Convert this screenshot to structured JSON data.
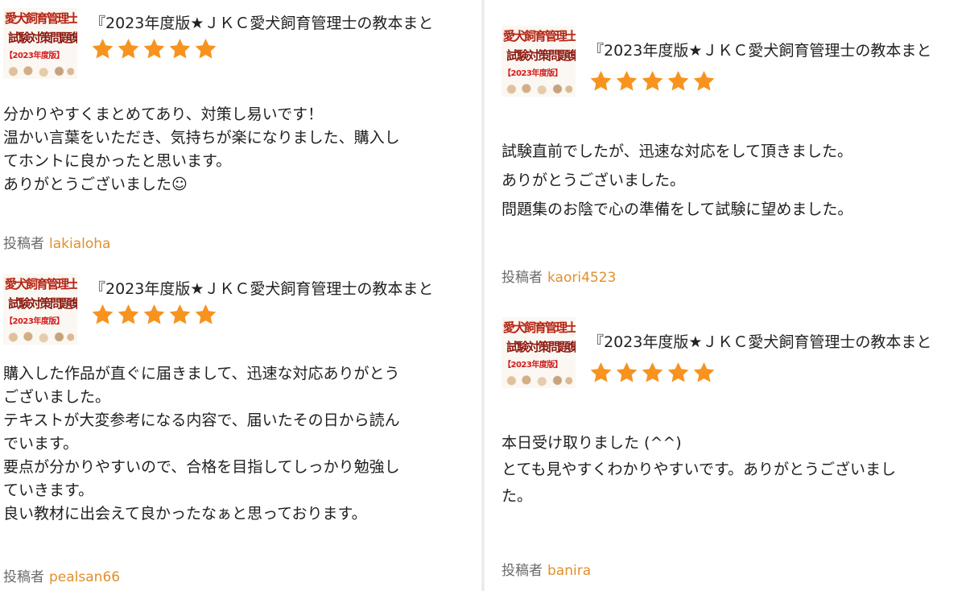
{
  "accent": "#f7931e",
  "username_color": "#e0902c",
  "product": {
    "thumb_line1": "愛犬飼育管理士",
    "thumb_line2": "試験対策問題集",
    "thumb_badge": "【2023年度版】",
    "title": "『2023年度版★ＪＫＣ愛犬飼育管理士の教本まと"
  },
  "byline_label": "投稿者",
  "reviews": [
    {
      "rating": 5,
      "body": "分かりやすくまとめてあり、対策し易いです！\n温かい言葉をいただき、気持ちが楽になりました、購入し\nてホントに良かったと思います。\nありがとうございました☺",
      "user": "lakialoha"
    },
    {
      "rating": 5,
      "body": "購入した作品が直ぐに届きまして、迅速な対応ありがとう\nございました。\nテキストが大変参考になる内容で、届いたその日から読ん\nでいます。\n要点が分かりやすいので、合格を目指してしっかり勉強し\nていきます。\n良い教材に出会えて良かったなぁと思っております。",
      "user": "pealsan66"
    },
    {
      "rating": 5,
      "body": "試験直前でしたが、迅速な対応をして頂きました。\nありがとうございました。\n問題集のお陰で心の準備をして試験に望めました。",
      "user": "kaori4523"
    },
    {
      "rating": 5,
      "body": "本日受け取りました (^^)\nとても見やすくわかりやすいです。ありがとうございまし\nた。",
      "user": "banira"
    }
  ]
}
